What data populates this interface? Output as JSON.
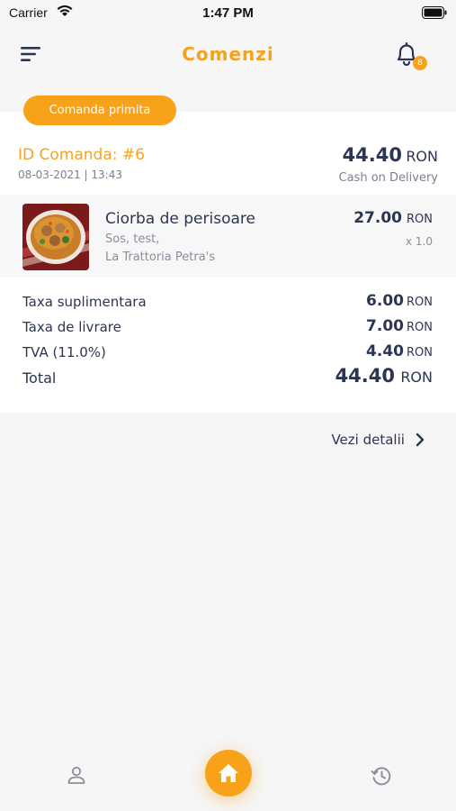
{
  "status_bar": {
    "carrier": "Carrier",
    "time": "1:47 PM"
  },
  "header": {
    "title": "Comenzi",
    "notification_count": "8"
  },
  "order": {
    "status": "Comanda primita",
    "id_label": "ID Comanda: #6",
    "date": "08-03-2021 | 13:43",
    "total_value": "44.40",
    "currency": "RON",
    "payment_method": "Cash on Delivery",
    "item": {
      "name": "Ciorba de perisoare",
      "description": "Sos, test,",
      "restaurant": "La Trattoria Petra's",
      "price": "27.00",
      "currency": "RON",
      "quantity": "x 1.0"
    },
    "totals": [
      {
        "label": "Taxa suplimentara",
        "value": "6.00",
        "currency": "RON"
      },
      {
        "label": "Taxa de livrare",
        "value": "7.00",
        "currency": "RON"
      },
      {
        "label": "TVA (11.0%)",
        "value": "4.40",
        "currency": "RON"
      },
      {
        "label": "Total",
        "value": "44.40",
        "currency": "RON"
      }
    ],
    "details_link": "Vezi detalii"
  },
  "tabbar": {
    "tabs": [
      "profile-icon",
      "home-icon",
      "history-icon"
    ]
  },
  "colors": {
    "accent": "#f8a21a",
    "text": "#2c3553",
    "muted": "#7a8090"
  }
}
